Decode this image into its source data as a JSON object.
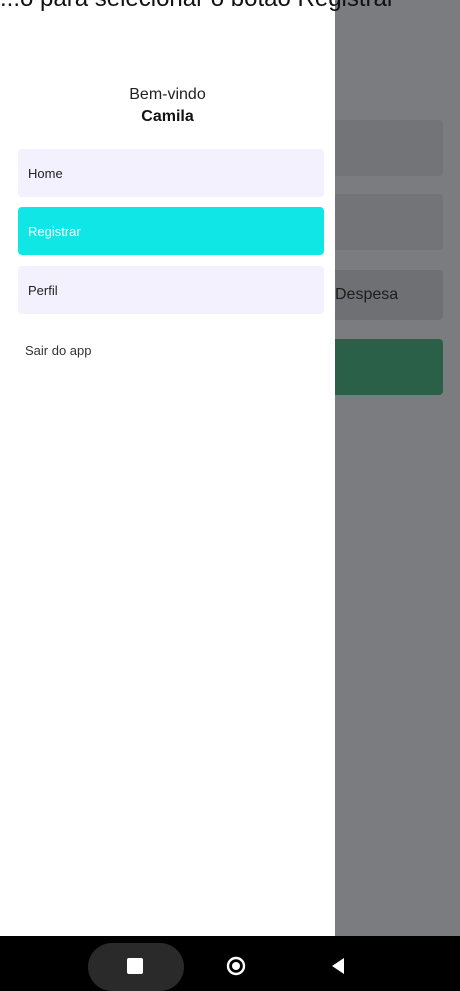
{
  "top_caption": "...o para selecionar o botão Registrar",
  "background": {
    "select_label": "Despesa"
  },
  "drawer": {
    "welcome": "Bem-vindo",
    "username": "Camila",
    "items": [
      {
        "label": "Home",
        "active": false
      },
      {
        "label": "Registrar",
        "active": true
      },
      {
        "label": "Perfil",
        "active": false
      }
    ],
    "logout_label": "Sair do app"
  },
  "colors": {
    "active_item": "#10e6e6",
    "item_bg": "#f2f1fd",
    "primary_button": "#00a84f",
    "scrim": "#3c3e44"
  },
  "system_nav": {
    "buttons": [
      "recents-icon",
      "home-icon",
      "back-icon"
    ]
  }
}
